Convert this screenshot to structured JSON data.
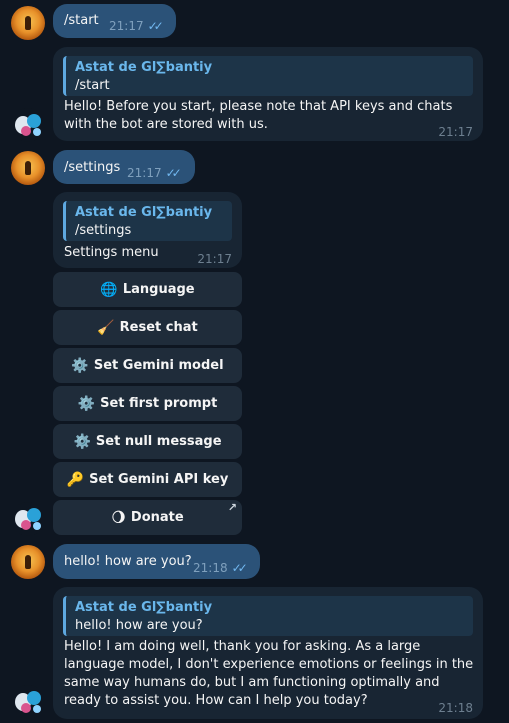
{
  "messages": {
    "m1": {
      "text": "/start",
      "time": "21:17",
      "status": "✓✓"
    },
    "m2": {
      "reply_name": "Astat de Gl∑bantiy",
      "reply_text": "/start",
      "text": "Hello! Before you start, please note that API keys and chats with the bot are stored with us.",
      "time": "21:17"
    },
    "m3": {
      "text": "/settings",
      "time": "21:17",
      "status": "✓✓"
    },
    "m4": {
      "reply_name": "Astat de Gl∑bantiy",
      "reply_text": "/settings",
      "text": "Settings menu",
      "time": "21:17"
    },
    "m5": {
      "text": "hello! how are you?",
      "time": "21:18",
      "status": "✓✓"
    },
    "m6": {
      "reply_name": "Astat de Gl∑bantiy",
      "reply_text": "hello! how are you?",
      "text": "Hello! I am doing well, thank you for asking. As a large language model, I don't experience emotions or feelings in the same way humans do, but I am functioning optimally and ready to assist you. How can I help you today?",
      "time": "21:18"
    }
  },
  "keyboard": [
    {
      "icon": "🌐",
      "label": "Language",
      "icon_name": "globe-icon"
    },
    {
      "icon": "🧹",
      "label": "Reset chat",
      "icon_name": "broom-icon"
    },
    {
      "icon": "⚙️",
      "label": "Set Gemini model",
      "icon_name": "gear-icon"
    },
    {
      "icon": "⚙️",
      "label": "Set first prompt",
      "icon_name": "gear-icon"
    },
    {
      "icon": "⚙️",
      "label": "Set null message",
      "icon_name": "gear-icon"
    },
    {
      "icon": "🔑",
      "label": "Set Gemini API key",
      "icon_name": "key-icon"
    },
    {
      "icon": "🌖",
      "label": "Donate",
      "icon_name": "moon-icon",
      "link_arrow": "↗"
    }
  ]
}
